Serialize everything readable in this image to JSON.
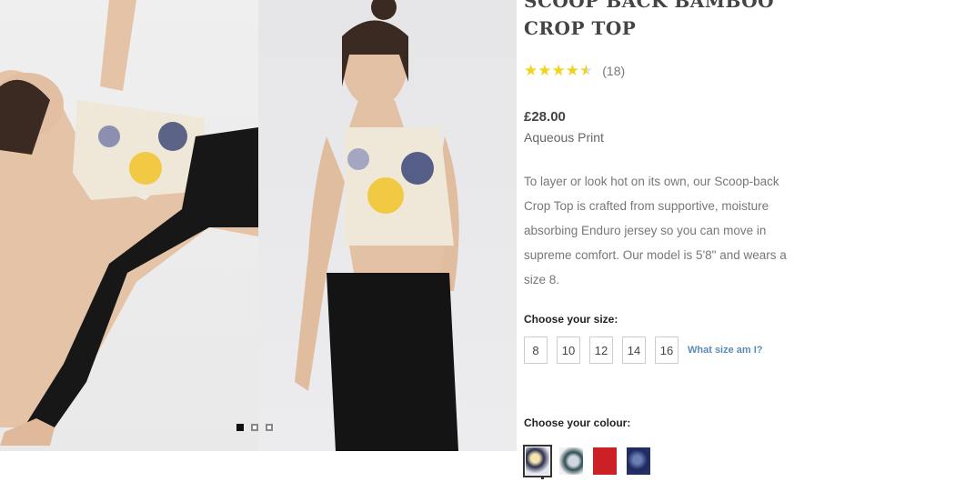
{
  "product": {
    "title_line1": "SCOOP BACK BAMBOO",
    "title_line2": "CROP TOP",
    "rating": 4.5,
    "review_count": "(18)",
    "price": "£28.00",
    "variant_name": "Aqueous Print",
    "description": "To layer or look hot on its own, our Scoop-back Crop Top is crafted from supportive, moisture absorbing Enduro jersey so you can move in supreme comfort. Our model is 5'8\" and wears a size 8."
  },
  "size_section": {
    "label": "Choose your size:",
    "sizes": [
      "8",
      "10",
      "12",
      "14",
      "16"
    ],
    "help_link": "What size am I?"
  },
  "colour_section": {
    "label": "Choose your colour:",
    "swatches": [
      {
        "name": "Aqueous Print",
        "color": "#2b2f4f",
        "selected": true
      },
      {
        "name": "Teal Print",
        "color": "#2f4f53",
        "selected": false
      },
      {
        "name": "Red",
        "color": "#cc2027",
        "selected": false
      },
      {
        "name": "Navy Print",
        "color": "#1f2a60",
        "selected": false
      }
    ]
  },
  "gallery": {
    "slide_count": 3,
    "active_slide": 1
  },
  "colors": {
    "star": "#f2d31b",
    "link": "#5a8cb8"
  }
}
